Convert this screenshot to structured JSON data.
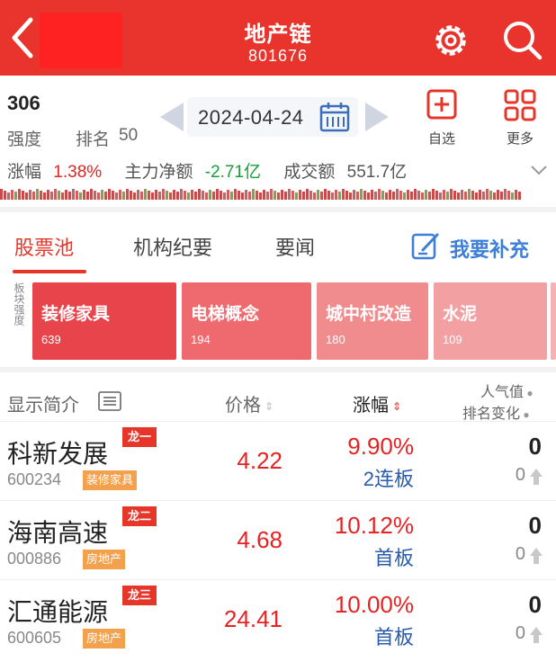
{
  "header": {
    "title": "地产链",
    "code": "801676",
    "colors": {
      "bar": "#e8342c"
    }
  },
  "info": {
    "strength_value": "306",
    "strength_label": "强度",
    "rank_label": "排名",
    "rank_value": "50",
    "date": "2024-04-24",
    "add_label": "自选",
    "more_label": "更多",
    "stats": {
      "change_label": "涨幅",
      "change_value": "1.38%",
      "mainflow_label": "主力净额",
      "mainflow_value": "-2.71亿",
      "volume_label": "成交额",
      "volume_value": "551.7亿"
    }
  },
  "tabs": [
    {
      "label": "股票池",
      "active": true
    },
    {
      "label": "机构纪要",
      "active": false
    },
    {
      "label": "要闻",
      "active": false
    }
  ],
  "supplement_label": "我要补充",
  "plates": {
    "side_label": "板块强度",
    "items": [
      {
        "name": "装修家具",
        "count": "639",
        "color": "#e8444c"
      },
      {
        "name": "电梯概念",
        "count": "194",
        "color": "#ef6a6e"
      },
      {
        "name": "城中村改造",
        "count": "180",
        "color": "#f18c8e"
      },
      {
        "name": "水泥",
        "count": "109",
        "color": "#f2a0a2"
      },
      {
        "name": "",
        "count": "",
        "color": "#f4b2b3"
      }
    ]
  },
  "list_header": {
    "intro": "显示简介",
    "price": "价格",
    "change": "涨幅",
    "pop_line1": "人气值",
    "pop_line2": "排名变化"
  },
  "stocks": [
    {
      "name": "科新发展",
      "code": "600234",
      "dragon": "龙一",
      "tag": "装修家具",
      "price": "4.22",
      "change": "9.90%",
      "board": "2连板",
      "pop": "0",
      "rank": "0"
    },
    {
      "name": "海南高速",
      "code": "000886",
      "dragon": "龙二",
      "tag": "房地产",
      "price": "4.68",
      "change": "10.12%",
      "board": "首板",
      "pop": "0",
      "rank": "0"
    },
    {
      "name": "汇通能源",
      "code": "600605",
      "dragon": "龙三",
      "tag": "房地产",
      "price": "24.41",
      "change": "10.00%",
      "board": "首板",
      "pop": "0",
      "rank": "0"
    }
  ]
}
